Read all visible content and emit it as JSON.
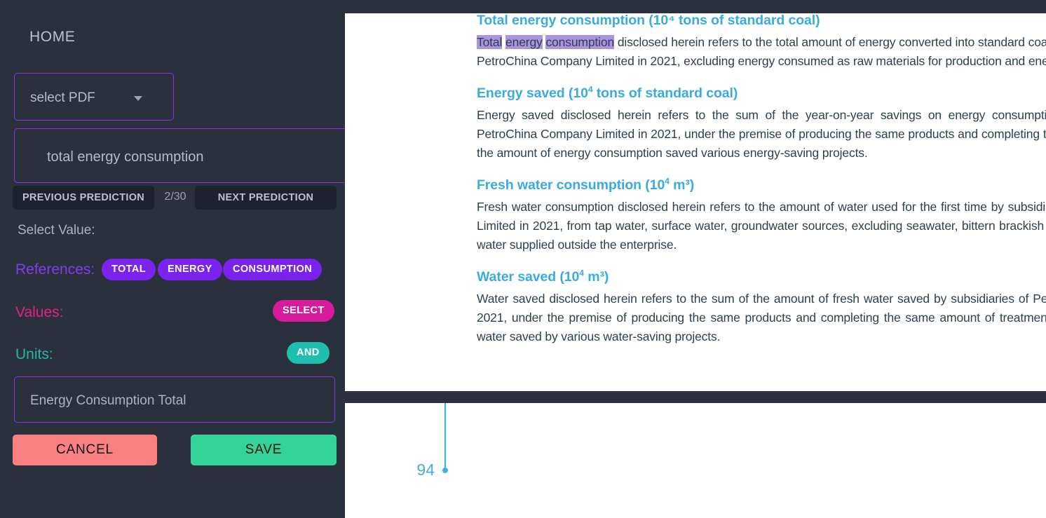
{
  "sidebar": {
    "home_label": "HOME",
    "pdf_select": {
      "label": "select PDF",
      "caret_icon": "chevron-down-icon"
    },
    "query_input": {
      "value": "total energy consumption"
    },
    "pager": {
      "previous_label": "PREVIOUS PREDICTION",
      "next_label": "NEXT PREDICTION",
      "count": "2/30"
    },
    "select_value_label": "Select Value:",
    "rows": {
      "references": {
        "label": "References:",
        "color": "#7c3ff0",
        "chips": [
          "TOTAL",
          "ENERGY",
          "CONSUMPTION"
        ]
      },
      "values": {
        "label": "Values:",
        "color": "#e0218a",
        "chips": [
          "SELECT"
        ]
      },
      "units": {
        "label": "Units:",
        "color": "#24b6a8",
        "chips": [
          "AND"
        ]
      }
    },
    "units_input": {
      "value": "Energy Consumption Total"
    },
    "actions": {
      "cancel_label": "CANCEL",
      "cancel_color": "#f98080",
      "save_label": "SAVE",
      "save_color": "#34d399"
    }
  },
  "document": {
    "clipped_heading": "Total energy consumption (10⁴ tons of standard coal)",
    "paragraph_1": {
      "highlighted": [
        "Total",
        "energy",
        "consumption"
      ],
      "rest": " disclosed herein refers to the total amount of energy converted into standard coal consumed by subsidiaries of PetroChina Company Limited in 2021, excluding energy consumed as raw materials for production and energy"
    },
    "sections": [
      {
        "heading_text": "Energy saved (10",
        "heading_sup": "4",
        "heading_tail": " tons of standard coal)",
        "body": "Energy saved disclosed herein refers to the sum of the year-on-year savings on energy consumption saved by subsidiaries of PetroChina Company Limited in 2021, under the premise of producing the same products and completing the same amount of work, and the amount of energy consumption saved various energy-saving projects."
      },
      {
        "heading_text": "Fresh water consumption (10",
        "heading_sup": "4",
        "heading_tail": " m³)",
        "body": "Fresh water consumption disclosed herein refers to the amount of water used for the first time by subsidiaries of PetroChina Company Limited in 2021, from tap water, surface water, groundwater sources, excluding seawater, bittern brackish water, sewage and reclaimed water supplied outside the enterprise."
      },
      {
        "heading_text": "Water saved (10",
        "heading_sup": "4",
        "heading_tail": " m³)",
        "body": "Water saved disclosed herein refers to the sum of the amount of fresh water saved by subsidiaries of PetroChina Company Limited in 2021, under the premise of producing the same products and completing the same amount of treatment or work, and the amount of water saved by various water-saving projects."
      }
    ]
  },
  "chart_data": {
    "type": "scatter",
    "title": "",
    "xlabel": "",
    "ylabel": "",
    "accent_color": "#41ade2",
    "points": [
      {
        "label": "94",
        "value": 94
      }
    ]
  }
}
